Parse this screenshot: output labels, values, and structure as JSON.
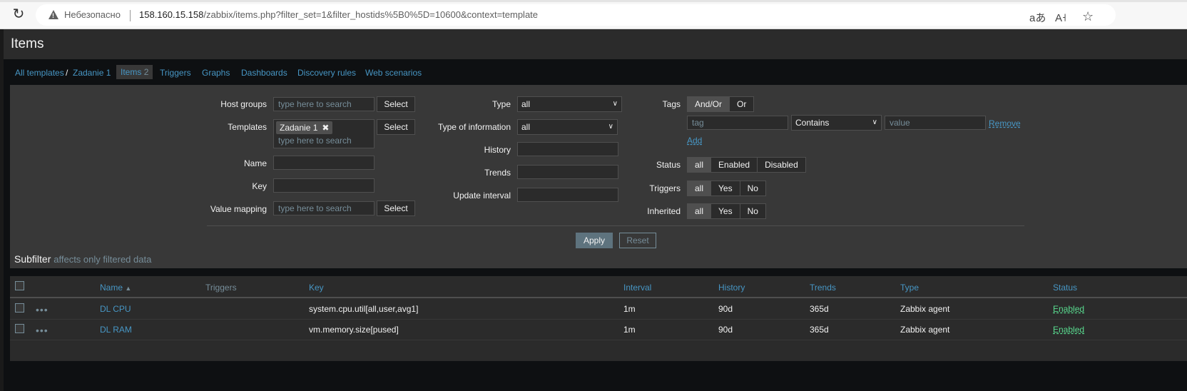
{
  "browser": {
    "insecure_label": "Небезопасно",
    "url_host": "158.160.15.158",
    "url_rest": "/zabbix/items.php?filter_set=1&filter_hostids%5B0%5D=10600&context=template",
    "reload_icon": "reload-icon",
    "warning_icon": "warning-triangle-icon"
  },
  "page": {
    "title": "Items"
  },
  "nav": {
    "all_templates": "All templates",
    "separator": "/",
    "template": "Zadanie 1",
    "items": "Items",
    "items_count": "2",
    "triggers": "Triggers",
    "graphs": "Graphs",
    "dashboards": "Dashboards",
    "discovery_rules": "Discovery rules",
    "web_scenarios": "Web scenarios"
  },
  "filter": {
    "host_groups_label": "Host groups",
    "host_groups_placeholder": "type here to search",
    "templates_label": "Templates",
    "templates_chip": "Zadanie 1",
    "templates_placeholder": "type here to search",
    "name_label": "Name",
    "key_label": "Key",
    "value_mapping_label": "Value mapping",
    "value_mapping_placeholder": "type here to search",
    "select_label": "Select",
    "type_label": "Type",
    "type_value": "all",
    "type_of_info_label": "Type of information",
    "type_of_info_value": "all",
    "history_label": "History",
    "trends_label": "Trends",
    "update_interval_label": "Update interval",
    "tags_label": "Tags",
    "tags_andor": "And/Or",
    "tags_or": "Or",
    "tag_placeholder": "tag",
    "tag_operator": "Contains",
    "tag_value_placeholder": "value",
    "remove_label": "Remove",
    "add_label": "Add",
    "status_label": "Status",
    "status_all": "all",
    "status_enabled": "Enabled",
    "status_disabled": "Disabled",
    "triggers_label": "Triggers",
    "inherited_label": "Inherited",
    "opt_all": "all",
    "opt_yes": "Yes",
    "opt_no": "No",
    "apply_label": "Apply",
    "reset_label": "Reset",
    "subfilter_title": "Subfilter",
    "subfilter_note": "affects only filtered data"
  },
  "table": {
    "headers": {
      "name": "Name",
      "sort_icon": "▲",
      "triggers": "Triggers",
      "key": "Key",
      "interval": "Interval",
      "history": "History",
      "trends": "Trends",
      "type": "Type",
      "status": "Status"
    },
    "rows": [
      {
        "name": "DL CPU",
        "key": "system.cpu.util[all,user,avg1]",
        "interval": "1m",
        "history": "90d",
        "trends": "365d",
        "type": "Zabbix agent",
        "status": "Enabled"
      },
      {
        "name": "DL RAM",
        "key": "vm.memory.size[pused]",
        "interval": "1m",
        "history": "90d",
        "trends": "365d",
        "type": "Zabbix agent",
        "status": "Enabled"
      }
    ]
  }
}
